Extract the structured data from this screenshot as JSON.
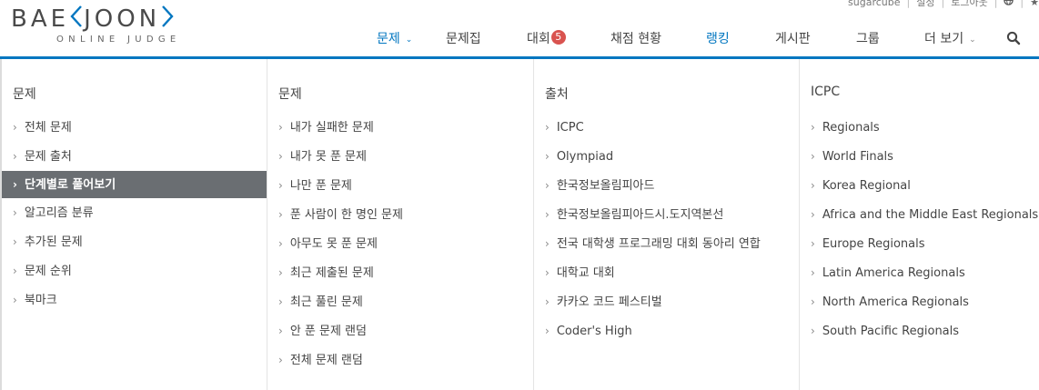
{
  "topbar": {
    "username": "sugarcube",
    "settings": "설정",
    "logout": "로그아웃"
  },
  "logo": {
    "word_left": "BAE",
    "word_right": "JOON",
    "subtitle": "ONLINE JUDGE"
  },
  "nav": {
    "problems": "문제",
    "workbook": "문제집",
    "contest": "대회",
    "contest_badge": "5",
    "status": "채점 현황",
    "ranking": "랭킹",
    "board": "게시판",
    "group": "그룹",
    "more": "더 보기"
  },
  "menu": {
    "columns": [
      {
        "title": "문제",
        "items": [
          "전체 문제",
          "문제 출처",
          "단계별로 풀어보기",
          "알고리즘 분류",
          "추가된 문제",
          "문제 순위",
          "북마크"
        ],
        "selected_index": 2
      },
      {
        "title": "문제",
        "items": [
          "내가 실패한 문제",
          "내가 못 푼 문제",
          "나만 푼 문제",
          "푼 사람이 한 명인 문제",
          "아무도 못 푼 문제",
          "최근 제출된 문제",
          "최근 풀린 문제",
          "안 푼 문제 랜덤",
          "전체 문제 랜덤"
        ]
      },
      {
        "title": "출처",
        "items": [
          "ICPC",
          "Olympiad",
          "한국정보올림피아드",
          "한국정보올림피아드시.도지역본선",
          "전국 대학생 프로그래밍 대회 동아리 연합",
          "대학교 대회",
          "카카오 코드 페스티벌",
          "Coder's High"
        ]
      },
      {
        "title": "ICPC",
        "items": [
          "Regionals",
          "World Finals",
          "Korea Regional",
          "Africa and the Middle East Regionals",
          "Europe Regionals",
          "Latin America Regionals",
          "North America Regionals",
          "South Pacific Regionals"
        ]
      }
    ]
  },
  "colors": {
    "accent": "#0076c0",
    "selected_bg": "#6a6e72",
    "badge": "#d9534f"
  },
  "icons": {
    "search": "search-icon",
    "globe": "globe-icon",
    "star": "star-icon",
    "chevron": "chevron-down-icon",
    "arrow": "chevron-right-icon"
  }
}
